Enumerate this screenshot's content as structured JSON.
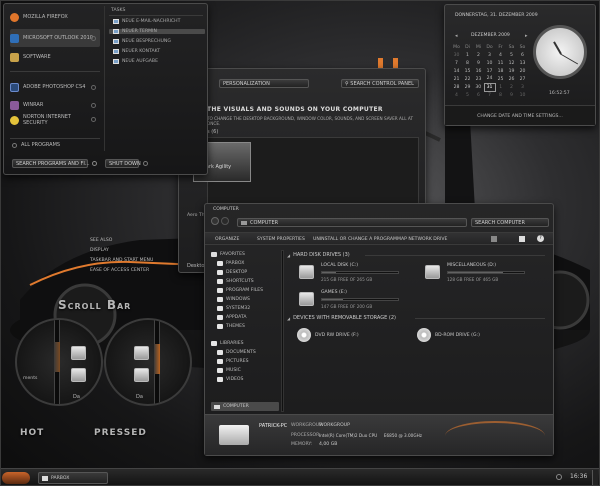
{
  "start_menu": {
    "programs": [
      {
        "label": "Mozilla Firefox",
        "color": "#e0762b"
      },
      {
        "label": "Microsoft Outlook 2010",
        "color": "#2f6fb8"
      },
      {
        "label": "Software",
        "color": "#c8a24a"
      },
      {
        "label": "Adobe Photoshop CS4",
        "color": "#2a4a7a"
      },
      {
        "label": "WinRAR",
        "color": "#8a5a9a"
      },
      {
        "label": "Norton Internet Security",
        "color": "#e3c23a"
      }
    ],
    "all_programs": "All Programs",
    "search_placeholder": "Search programs and fi...",
    "shutdown": "Shut down",
    "tasks_title": "Tasks",
    "tasks": [
      "Neue E-Mail-Nachricht",
      "Neuer Termin",
      "Neue Besprechung",
      "Neuer Kontakt",
      "Neue Aufgabe"
    ]
  },
  "personalization": {
    "breadcrumb": "Personalization",
    "search": "Search Control Panel",
    "heading": "the visuals and sounds on your computer",
    "subtext": "to change the desktop background, window color, sounds, and screen saver all at once.",
    "section": "s (6)",
    "theme_name": "Dark Agility",
    "left_label": "Aero Th..."
  },
  "cp_links": [
    "See also",
    "Display",
    "Taskbar and Start Menu",
    "Ease of Access Center"
  ],
  "desktop_label": "Desktop",
  "calendar": {
    "date_full": "Donnerstag, 31. Dezember 2009",
    "month": "Dezember 2009",
    "weekdays": [
      "Mo",
      "Di",
      "Mi",
      "Do",
      "Fr",
      "Sa",
      "So"
    ],
    "weeks": [
      [
        "30",
        "1",
        "2",
        "3",
        "4",
        "5",
        "6"
      ],
      [
        "7",
        "8",
        "9",
        "10",
        "11",
        "12",
        "13"
      ],
      [
        "14",
        "15",
        "16",
        "17",
        "18",
        "19",
        "20"
      ],
      [
        "21",
        "22",
        "23",
        "24",
        "25",
        "26",
        "27"
      ],
      [
        "28",
        "29",
        "30",
        "31",
        "1",
        "2",
        "3"
      ],
      [
        "4",
        "5",
        "6",
        "7",
        "8",
        "9",
        "10"
      ]
    ],
    "selected": "31",
    "time": "16:52:57",
    "change_link": "Change date and time settings..."
  },
  "explorer": {
    "title": "Computer",
    "address": "Computer",
    "search": "Search Computer",
    "toolbar": [
      "Organize",
      "System properties",
      "Uninstall or change a program",
      "Map network drive"
    ],
    "favorites_title": "Favorites",
    "favorites": [
      "Parbox",
      "Desktop",
      "Shortcuts",
      "Program Files",
      "Windows",
      "System32",
      "AppData",
      "Themes"
    ],
    "libraries_title": "Libraries",
    "libraries": [
      "Documents",
      "Pictures",
      "Music",
      "Videos"
    ],
    "computer_item": "Computer",
    "hdd_group": "Hard Disk Drives (3)",
    "drives": [
      {
        "name": "Local Disk (C:)",
        "free": "215 GB free of 265 GB",
        "used": 0.19
      },
      {
        "name": "Miscellaneous (D:)",
        "free": "128 GB free of 465 GB",
        "used": 0.72
      },
      {
        "name": "Games (E:)",
        "free": "147 GB free of 200 GB",
        "used": 0.27
      }
    ],
    "removable_group": "Devices with Removable Storage (2)",
    "removable": [
      "DVD RW Drive (F:)",
      "BD-ROM Drive (G:)"
    ],
    "details": {
      "pc_name": "PATRICK-PC",
      "workgroup_label": "Workgroup:",
      "workgroup": "WORKGROUP",
      "processor_label": "Processor:",
      "processor": "Intel(R) Core(TM)2 Duo CPU     E6850 @ 3.00GHz",
      "memory_label": "Memory:",
      "memory": "4,00 GB"
    }
  },
  "labels": {
    "scrollbar": "Scroll Bar",
    "hot": "Hot",
    "pressed": "Pressed",
    "scroll_left_text": "ments",
    "scroll_left_bottom": "Da",
    "scroll_right_bottom": "Da"
  },
  "taskbar": {
    "task": "Parbox",
    "clock": "16:36"
  },
  "colors": {
    "accent": "#e07a2e",
    "background": "#161617",
    "panel": "#242425"
  }
}
